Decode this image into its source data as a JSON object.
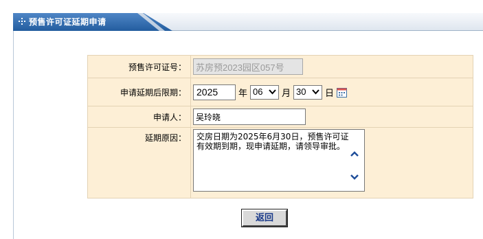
{
  "header": {
    "title": "预售许可证延期申请",
    "icon": "grid-bullet-icon"
  },
  "form": {
    "permit": {
      "label": "预售许可证号：",
      "value": "苏房预2023园区057号"
    },
    "deadline": {
      "label": "申请延期后限期：",
      "year": "2025",
      "year_unit": "年",
      "month": "06",
      "month_unit": "月",
      "day": "30",
      "day_unit": "日"
    },
    "applicant": {
      "label": "申请人：",
      "value": "吴玲晓"
    },
    "reason": {
      "label": "延期原因：",
      "value": "交房日期为2025年6月30日，预售许可证有效期到期，现申请延期，请领导审批。"
    }
  },
  "actions": {
    "back_label": "返回"
  },
  "colors": {
    "header": "#235d9f",
    "form_bg": "#fdefd6",
    "button_text": "#1a3a8a"
  }
}
